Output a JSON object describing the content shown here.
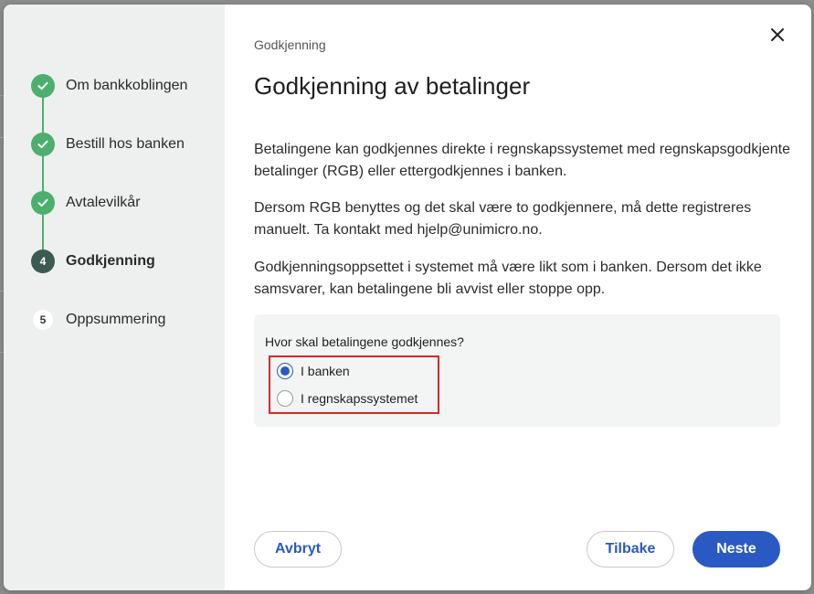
{
  "dialog": {
    "breadcrumb": "Godkjenning",
    "title": "Godkjenning av betalinger",
    "paragraphs": [
      "Betalingene kan godkjennes direkte i regnskapssystemet med regnskapsgodkjente betalinger (RGB) eller ettergodkjennes i banken.",
      "Dersom RGB benyttes og det skal være to godkjennere, må dette registreres manuelt. Ta kontakt med hjelp@unimicro.no.",
      "Godkjenningsoppsettet i systemet må være likt som i banken. Dersom det ikke samsvarer, kan betalingene bli avvist eller stoppe opp."
    ],
    "question": {
      "label": "Hvor skal betalingene godkjennes?",
      "options": [
        {
          "label": "I banken",
          "checked": true
        },
        {
          "label": "I regnskapssystemet",
          "checked": false
        }
      ]
    },
    "buttons": {
      "cancel": "Avbryt",
      "back": "Tilbake",
      "next": "Neste"
    }
  },
  "steps": [
    {
      "number": "1",
      "label": "Om bankkoblingen",
      "state": "done"
    },
    {
      "number": "2",
      "label": "Bestill hos banken",
      "state": "done"
    },
    {
      "number": "3",
      "label": "Avtalevilkår",
      "state": "done"
    },
    {
      "number": "4",
      "label": "Godkjenning",
      "state": "active"
    },
    {
      "number": "5",
      "label": "Oppsummering",
      "state": "todo"
    }
  ],
  "colors": {
    "accent": "#2b59c3",
    "step_done": "#4caf6e",
    "step_active": "#3a5a52",
    "highlight": "#d9262b"
  },
  "icons": {
    "close": "close-icon",
    "check": "check-icon"
  }
}
